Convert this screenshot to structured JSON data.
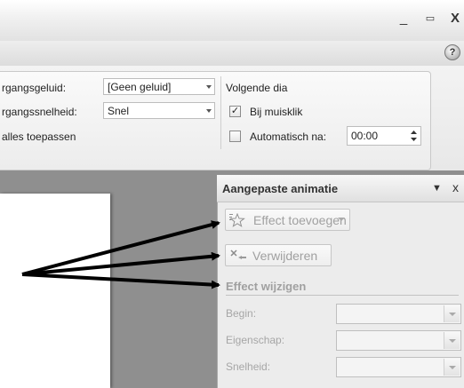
{
  "window": {
    "minimize_glyph": "_",
    "restore_glyph": "▭",
    "close_glyph": "X"
  },
  "help": {
    "glyph": "?"
  },
  "ribbon": {
    "sound_label": "rgangsgeluid:",
    "sound_value": "[Geen geluid]",
    "speed_label": "rgangssnelheid:",
    "speed_value": "Snel",
    "apply_all_label": "alles toepassen",
    "next_slide_heading": "Volgende dia",
    "on_click_label": "Bij muisklik",
    "on_click_checked": true,
    "auto_after_label": "Automatisch na:",
    "auto_after_checked": false,
    "auto_after_value": "00:00"
  },
  "pane": {
    "title": "Aangepaste animatie",
    "menu_glyph": "▼",
    "close_glyph": "x",
    "add_effect_label": "Effect toevoegen",
    "remove_label": "Verwijderen",
    "change_effect_heading": "Effect wijzigen",
    "fields": [
      {
        "label": "Begin:"
      },
      {
        "label": "Eigenschap:"
      },
      {
        "label": "Snelheid:"
      }
    ]
  },
  "colors": {
    "background": "#8f8f8f",
    "pane": "#ececec",
    "disabled_text": "#a6a6a6",
    "arrow": "#000000"
  }
}
